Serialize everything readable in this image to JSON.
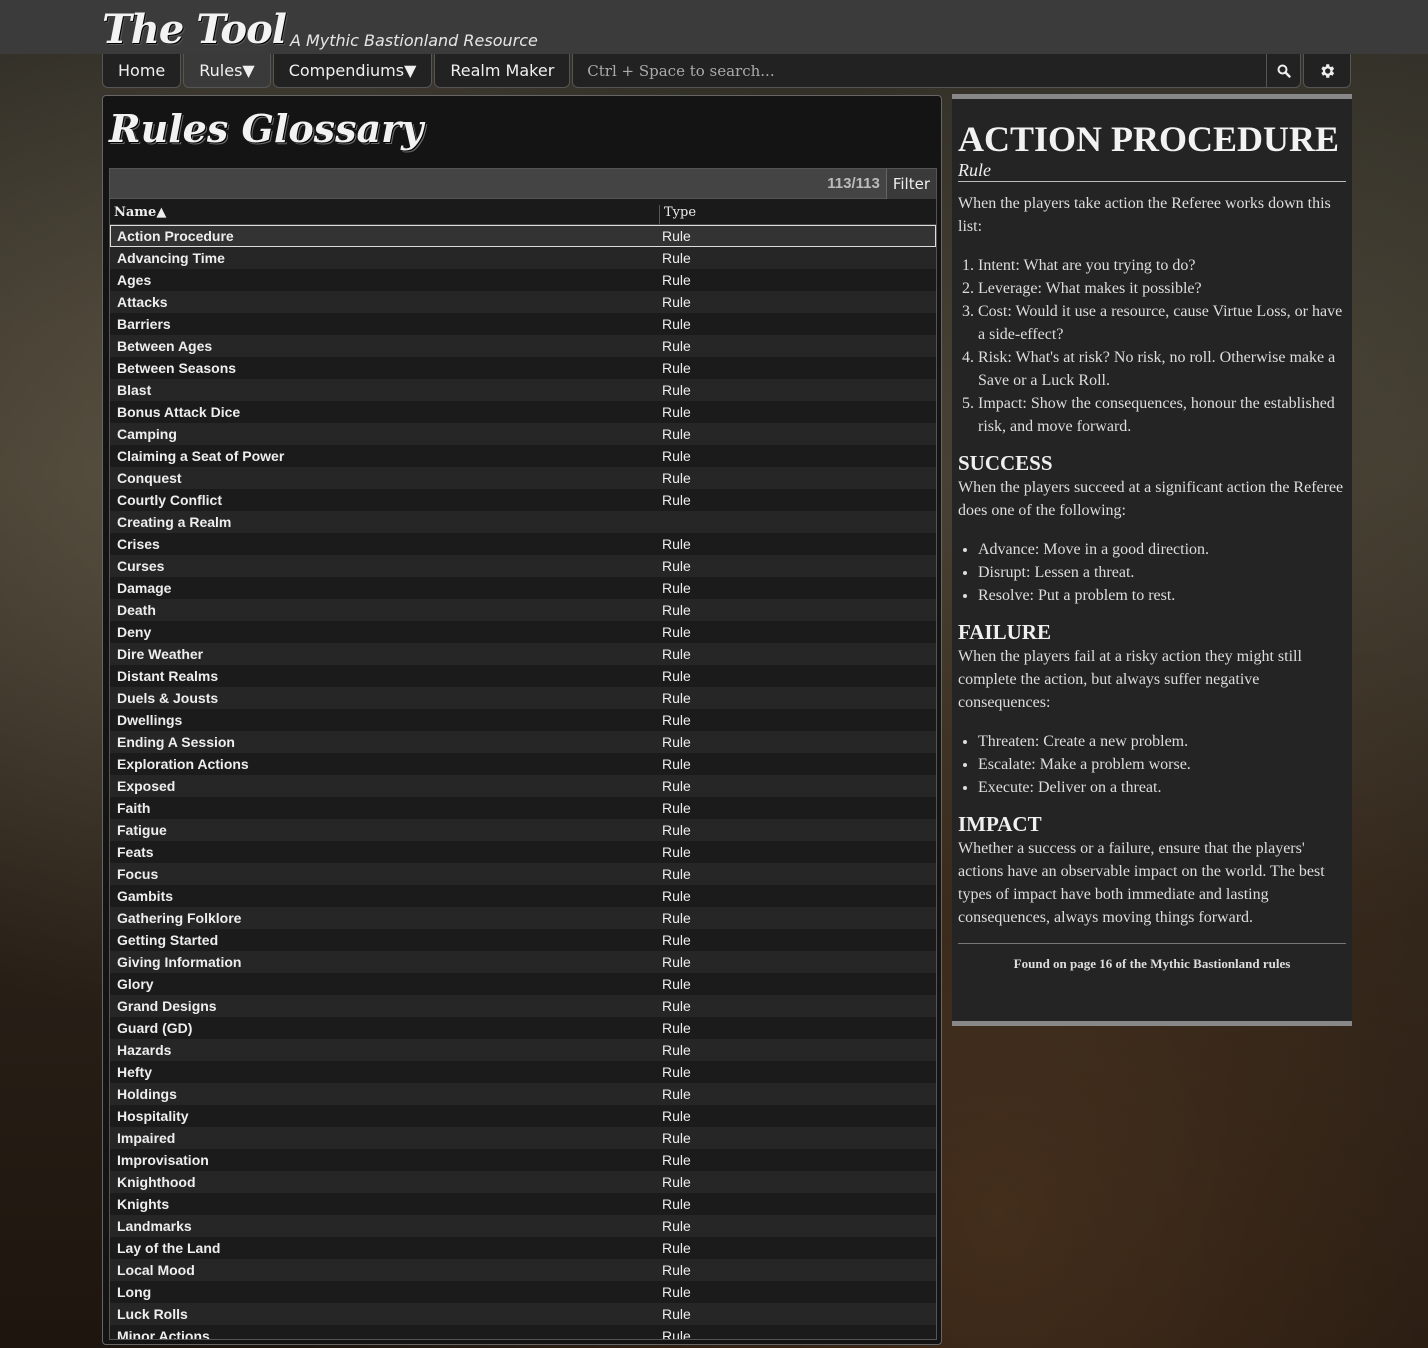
{
  "header": {
    "brand_name": "The Tool",
    "brand_tagline": "A Mythic Bastionland Resource"
  },
  "nav": {
    "home": "Home",
    "rules": "Rules▼",
    "compendiums": "Compendiums▼",
    "realm_maker": "Realm Maker",
    "search_placeholder": "Ctrl + Space to search..."
  },
  "glossary": {
    "title": "Rules Glossary",
    "count": "113/113",
    "filter_label": "Filter",
    "col_name": "Name▲",
    "col_type": "Type",
    "rows": [
      {
        "name": "Action Procedure",
        "type": "Rule"
      },
      {
        "name": "Advancing Time",
        "type": "Rule"
      },
      {
        "name": "Ages",
        "type": "Rule"
      },
      {
        "name": "Attacks",
        "type": "Rule"
      },
      {
        "name": "Barriers",
        "type": "Rule"
      },
      {
        "name": "Between Ages",
        "type": "Rule"
      },
      {
        "name": "Between Seasons",
        "type": "Rule"
      },
      {
        "name": "Blast",
        "type": "Rule"
      },
      {
        "name": "Bonus Attack Dice",
        "type": "Rule"
      },
      {
        "name": "Camping",
        "type": "Rule"
      },
      {
        "name": "Claiming a Seat of Power",
        "type": "Rule"
      },
      {
        "name": "Conquest",
        "type": "Rule"
      },
      {
        "name": "Courtly Conflict",
        "type": "Rule"
      },
      {
        "name": "Creating a Realm",
        "type": ""
      },
      {
        "name": "Crises",
        "type": "Rule"
      },
      {
        "name": "Curses",
        "type": "Rule"
      },
      {
        "name": "Damage",
        "type": "Rule"
      },
      {
        "name": "Death",
        "type": "Rule"
      },
      {
        "name": "Deny",
        "type": "Rule"
      },
      {
        "name": "Dire Weather",
        "type": "Rule"
      },
      {
        "name": "Distant Realms",
        "type": "Rule"
      },
      {
        "name": "Duels & Jousts",
        "type": "Rule"
      },
      {
        "name": "Dwellings",
        "type": "Rule"
      },
      {
        "name": "Ending A Session",
        "type": "Rule"
      },
      {
        "name": "Exploration Actions",
        "type": "Rule"
      },
      {
        "name": "Exposed",
        "type": "Rule"
      },
      {
        "name": "Faith",
        "type": "Rule"
      },
      {
        "name": "Fatigue",
        "type": "Rule"
      },
      {
        "name": "Feats",
        "type": "Rule"
      },
      {
        "name": "Focus",
        "type": "Rule"
      },
      {
        "name": "Gambits",
        "type": "Rule"
      },
      {
        "name": "Gathering Folklore",
        "type": "Rule"
      },
      {
        "name": "Getting Started",
        "type": "Rule"
      },
      {
        "name": "Giving Information",
        "type": "Rule"
      },
      {
        "name": "Glory",
        "type": "Rule"
      },
      {
        "name": "Grand Designs",
        "type": "Rule"
      },
      {
        "name": "Guard (GD)",
        "type": "Rule"
      },
      {
        "name": "Hazards",
        "type": "Rule"
      },
      {
        "name": "Hefty",
        "type": "Rule"
      },
      {
        "name": "Holdings",
        "type": "Rule"
      },
      {
        "name": "Hospitality",
        "type": "Rule"
      },
      {
        "name": "Impaired",
        "type": "Rule"
      },
      {
        "name": "Improvisation",
        "type": "Rule"
      },
      {
        "name": "Knighthood",
        "type": "Rule"
      },
      {
        "name": "Knights",
        "type": "Rule"
      },
      {
        "name": "Landmarks",
        "type": "Rule"
      },
      {
        "name": "Lay of the Land",
        "type": "Rule"
      },
      {
        "name": "Local Mood",
        "type": "Rule"
      },
      {
        "name": "Long",
        "type": "Rule"
      },
      {
        "name": "Luck Rolls",
        "type": "Rule"
      },
      {
        "name": "Minor Actions",
        "type": "Rule"
      }
    ]
  },
  "detail": {
    "title": "ACTION PROCEDURE",
    "subtitle": "Rule",
    "intro": "When the players take action the Referee works down this list:",
    "steps": [
      "Intent: What are you trying to do?",
      "Leverage: What makes it possible?",
      "Cost: Would it use a resource, cause Virtue Loss, or have a side-effect?",
      "Risk: What's at risk? No risk, no roll. Otherwise make a Save or a Luck Roll.",
      "Impact: Show the consequences, honour the established risk, and move forward."
    ],
    "success_heading": "SUCCESS",
    "success_text": "When the players succeed at a significant action the Referee does one of the following:",
    "success_items": [
      "Advance: Move in a good direction.",
      "Disrupt: Lessen a threat.",
      "Resolve: Put a problem to rest."
    ],
    "failure_heading": "FAILURE",
    "failure_text": "When the players fail at a risky action they might still complete the action, but always suffer negative consequences:",
    "failure_items": [
      "Threaten: Create a new problem.",
      "Escalate: Make a problem worse.",
      "Execute: Deliver on a threat."
    ],
    "impact_heading": "IMPACT",
    "impact_text": "Whether a success or a failure, ensure that the players' actions have an observable impact on the world. The best types of impact have both immediate and lasting consequences, always moving things forward.",
    "footer": "Found on page 16 of the Mythic Bastionland rules"
  }
}
